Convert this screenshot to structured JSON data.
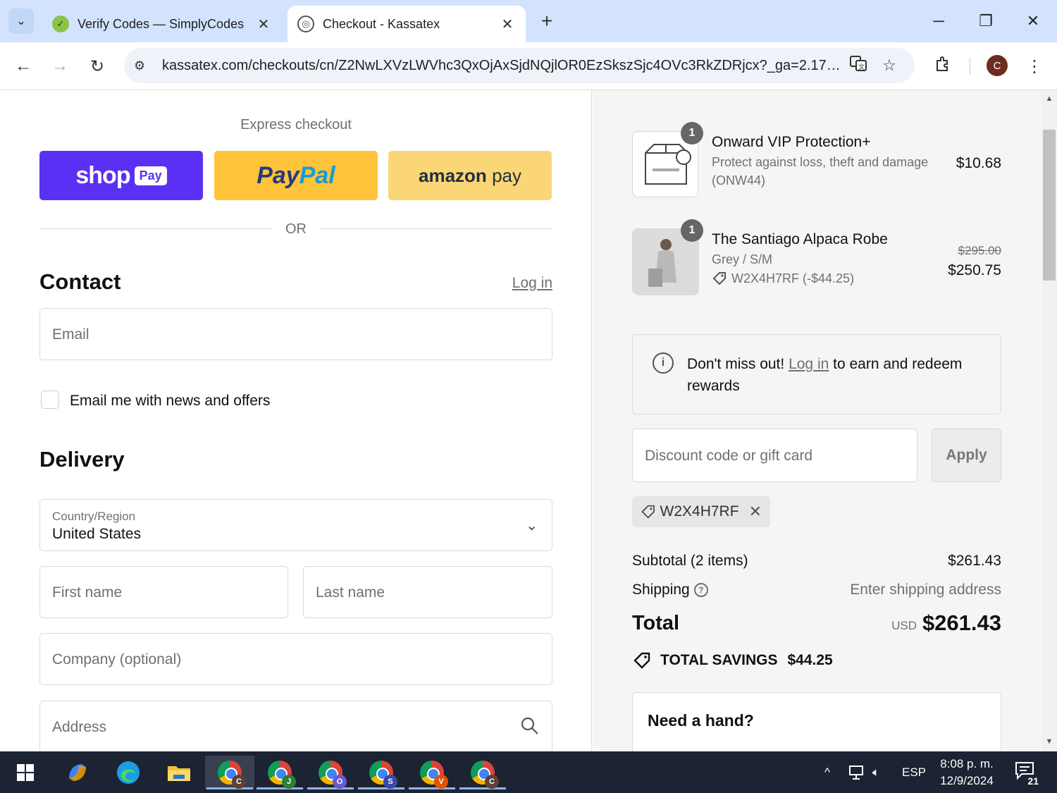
{
  "browser": {
    "tabs": [
      {
        "title": "Verify Codes — SimplyCodes",
        "favicon": "simplycodes-icon",
        "active": false
      },
      {
        "title": "Checkout - Kassatex",
        "favicon": "globe-icon",
        "active": true
      }
    ],
    "url": "kassatex.com/checkouts/cn/Z2NwLXVzLWVhc3QxOjAxSjdNQjlOR0EzSkszSjc4OVc3RkZDRjcx?_ga=2.177...",
    "profile_initial": "C"
  },
  "express": {
    "title": "Express checkout",
    "shop_pay": {
      "word": "shop",
      "badge": "Pay"
    },
    "paypal": {
      "part1": "Pay",
      "part2": "Pal"
    },
    "amazon": {
      "part1": "amazon",
      "part2": "pay"
    },
    "or": "OR"
  },
  "contact": {
    "heading": "Contact",
    "login": "Log in",
    "email_placeholder": "Email",
    "newsletter_label": "Email me with news and offers"
  },
  "delivery": {
    "heading": "Delivery",
    "country_label": "Country/Region",
    "country_value": "United States",
    "first_name": "First name",
    "last_name": "Last name",
    "company": "Company (optional)",
    "address": "Address"
  },
  "summary": {
    "items": [
      {
        "qty": "1",
        "name": "Onward VIP Protection+",
        "desc": "Protect against loss, theft and damage",
        "desc2": "(ONW44)",
        "price": "$10.68"
      },
      {
        "qty": "1",
        "name": "The Santiago Alpaca Robe",
        "variant": "Grey / S/M",
        "discount": "W2X4H7RF (-$44.25)",
        "old_price": "$295.00",
        "price": "$250.75"
      }
    ],
    "rewards": {
      "prefix": "Don't miss out!",
      "link": "Log in",
      "suffix": "to earn and redeem rewards"
    },
    "discount_placeholder": "Discount code or gift card",
    "apply": "Apply",
    "applied_code": "W2X4H7RF",
    "subtotal_label": "Subtotal (2 items)",
    "subtotal_value": "$261.43",
    "shipping_label": "Shipping",
    "shipping_value": "Enter shipping address",
    "total_label": "Total",
    "currency": "USD",
    "total_value": "$261.43",
    "savings_label": "TOTAL SAVINGS",
    "savings_value": "$44.25",
    "help_title": "Need a hand?"
  },
  "taskbar": {
    "chrome_profiles": [
      {
        "letter": "C",
        "color": "#5d4037"
      },
      {
        "letter": "J",
        "color": "#2e7d32"
      },
      {
        "letter": "O",
        "color": "#6a5acd"
      },
      {
        "letter": "S",
        "color": "#3949ab"
      },
      {
        "letter": "V",
        "color": "#e65100"
      },
      {
        "letter": "C",
        "color": "#5d4037"
      }
    ],
    "lang": "ESP",
    "time": "8:08 p. m.",
    "date": "12/9/2024",
    "notifications": "21"
  },
  "colors": {
    "shop_pay": "#5a31f4",
    "paypal": "#ffc439",
    "amazon_pay": "#fad676"
  }
}
